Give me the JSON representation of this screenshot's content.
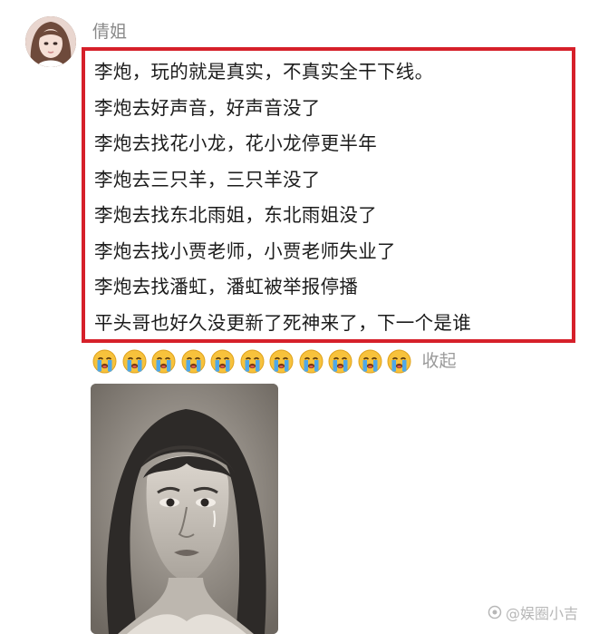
{
  "user": {
    "name": "倩姐",
    "avatar_icon": "avatar-girl-icon"
  },
  "post": {
    "lines": [
      "李炮，玩的就是真实，不真实全干下线。",
      "李炮去好声音，好声音没了",
      "李炮去找花小龙，花小龙停更半年",
      "李炮去三只羊，三只羊没了",
      "李炮去找东北雨姐，东北雨姐没了",
      "李炮去找小贾老师，小贾老师失业了",
      "李炮去找潘虹，潘虹被举报停播",
      "平头哥也好久没更新了死神来了，下一个是谁"
    ],
    "highlight_color": "#d6202a"
  },
  "reactions": {
    "emoji_icon": "crying-face-icon",
    "count": 11,
    "collapse_label": "收起"
  },
  "image": {
    "icon": "sketch-portrait-icon"
  },
  "watermark": {
    "text": "@娱圈小吉"
  }
}
